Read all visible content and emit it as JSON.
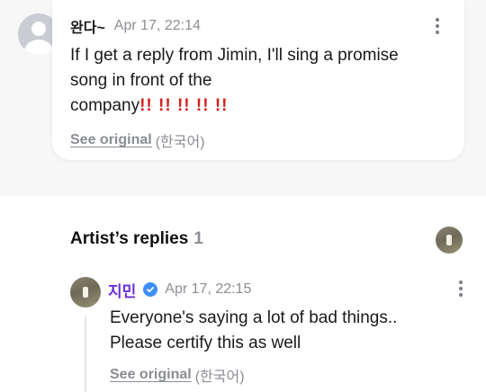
{
  "fan_post": {
    "author": "완다~",
    "timestamp": "Apr 17, 22:14",
    "text_line1": "If I get a reply from Jimin, I'll sing a promise",
    "text_line2": "song in front of the",
    "text_line3": "company",
    "emphasis": "!! !! !! !! !!",
    "see_original_label": "See original",
    "original_language": "(한국어)",
    "more_icon": "more-vertical-icon"
  },
  "replies_section": {
    "title": "Artist’s replies",
    "count": "1"
  },
  "artist_reply": {
    "author": "지민",
    "verified_icon": "verified-badge-icon",
    "timestamp": "Apr 17, 22:15",
    "text_line1": "Everyone's saying a lot of bad things..",
    "text_line2": "Please certify this as well",
    "see_original_label": "See original",
    "original_language": "(한국어)",
    "more_icon": "more-vertical-icon"
  },
  "colors": {
    "artist_name": "#6b2fd6",
    "verified_badge": "#3e8ef7",
    "emphasis_red": "#d61f1f",
    "muted_text": "#8a8d93"
  }
}
